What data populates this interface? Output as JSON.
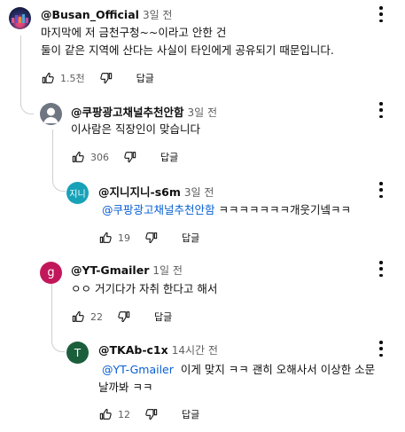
{
  "comments": [
    {
      "handle": "@Busan_Official",
      "time": "3일 전",
      "line1": "마지막에 저 금천구청~~이라고 안한 건",
      "line2": "둘이 같은 지역에 산다는 사실이 타인에게 공유되기 때문입니다.",
      "likes": "1.5천",
      "reply_label": "답글"
    },
    {
      "handle": "@쿠팡광고채널추천안함",
      "time": "3일 전",
      "text": "이사람은 직장인이 맞습니다",
      "likes": "306",
      "reply_label": "답글"
    },
    {
      "avatar_text": "지니",
      "handle": "@지니지니-s6m",
      "time": "3일 전",
      "mention": "@쿠팡광고채널추천안함",
      "text": "ㅋㅋㅋㅋㅋㅋㅋ개웃기넼ㅋㅋ",
      "likes": "19",
      "reply_label": "답글"
    },
    {
      "avatar_text": "g",
      "handle": "@YT-Gmailer",
      "time": "1일 전",
      "text": "ㅇㅇ 거기다가 자취 한다고 해서",
      "likes": "22",
      "reply_label": "답글"
    },
    {
      "avatar_text": "T",
      "handle": "@TKAb-c1x",
      "time": "14시간 전",
      "mention": "@YT-Gmailer",
      "line1": "이게 맞지 ㅋㅋ 괜히 오해사서 이상한 소문",
      "line2": "날까봐 ㅋㅋ",
      "likes": "12",
      "reply_label": "답글"
    }
  ],
  "colors": {
    "mention": "#065fd4",
    "avatar_jini": "#17a2b8",
    "avatar_g": "#c2185b",
    "avatar_t": "#1b5e3b"
  }
}
